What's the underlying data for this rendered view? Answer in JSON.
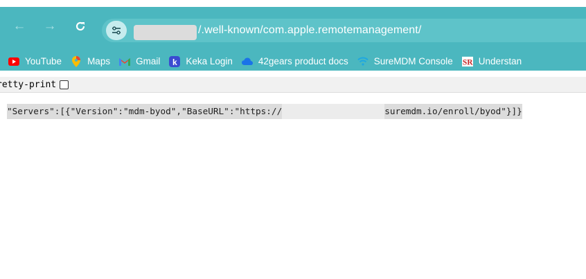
{
  "browser": {
    "url_visible": "/.well-known/com.apple.remotemanagement/",
    "nav_icons": [
      "back-arrow-icon",
      "forward-arrow-icon",
      "reload-icon",
      "site-settings-icon"
    ]
  },
  "bookmarks": [
    {
      "label": "YouTube",
      "icon": "youtube-icon",
      "color": "#ff0000"
    },
    {
      "label": "Maps",
      "icon": "maps-icon",
      "color": "#fbbc04"
    },
    {
      "label": "Gmail",
      "icon": "gmail-icon",
      "color": "#ea4335"
    },
    {
      "label": "Keka Login",
      "icon": "keka-icon",
      "color": "#3a4cd1"
    },
    {
      "label": "42gears product docs",
      "icon": "cloud-icon",
      "color": "#1a73e8"
    },
    {
      "label": "SureMDM Console",
      "icon": "wifi-icon",
      "color": "#1ea7e1"
    },
    {
      "label": "Understan",
      "icon": "sr-icon",
      "color": "#c62828"
    }
  ],
  "pretty_print": {
    "label": "retty-print",
    "checked": false
  },
  "json_text": {
    "before": "\"Servers\":[{\"Version\":\"mdm-byod\",\"BaseURL\":\"https://",
    "after": "suremdm.io/enroll/byod\"}]}"
  },
  "colors": {
    "toolbar": "#4bb7bf",
    "omnibox": "#5ec3c9",
    "highlight": "#dcdcdc"
  }
}
